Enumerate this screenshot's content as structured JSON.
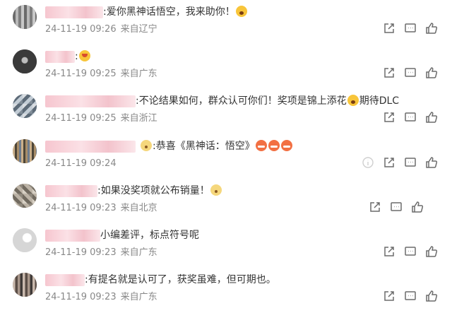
{
  "colors": {
    "meta_text": "#888888",
    "body_text": "#333333",
    "name_blur": "#f6c6cf",
    "icon": "#6b6b6b"
  },
  "comments": [
    {
      "text": ":爱你黑神话悟空，我来助你！",
      "emoji": [
        "wow"
      ],
      "date": "24-11-19 09:26",
      "location": "来自辽宁",
      "reply_icon": "reply-icon",
      "comment_icon": "comment-icon",
      "like_icon": "like-icon"
    },
    {
      "text": ":",
      "emoji": [
        "heart-eyes"
      ],
      "date": "24-11-19 09:25",
      "location": "来自广东",
      "reply_icon": "reply-icon",
      "comment_icon": "comment-icon",
      "like_icon": "like-icon"
    },
    {
      "text": ":不论结果如何，群众认可你们！奖项是锦上添花",
      "text_after": "期待DLC",
      "emoji": [
        "wow"
      ],
      "date": "24-11-19 09:25",
      "location": "来自浙江",
      "reply_icon": "reply-icon",
      "comment_icon": "comment-icon",
      "like_icon": "like-icon"
    },
    {
      "text": ":恭喜《黑神话：悟空》",
      "emoji": [
        "angry",
        "angry",
        "angry"
      ],
      "date": "24-11-19 09:24",
      "location": "",
      "info_icon": "info-icon",
      "reply_icon": "reply-icon",
      "comment_icon": "comment-icon",
      "like_icon": "like-icon"
    },
    {
      "text": ":如果没奖项就公布销量！",
      "emoji": [
        "cat"
      ],
      "date": "24-11-19 09:23",
      "location": "来自北京",
      "reply_icon": "reply-icon",
      "comment_icon": "comment-icon",
      "like_icon": "like-icon"
    },
    {
      "text": "小编差评，标点符号呢",
      "emoji": [],
      "date": "24-11-19 09:23",
      "location": "来自广东",
      "reply_icon": "reply-icon",
      "comment_icon": "comment-icon",
      "like_icon": "like-icon"
    },
    {
      "text": ":有提名就是认可了，获奖虽难，但可期也。",
      "emoji": [],
      "date": "24-11-19 09:23",
      "location": "来自广东",
      "reply_icon": "reply-icon",
      "comment_icon": "comment-icon",
      "like_icon": "like-icon"
    }
  ]
}
